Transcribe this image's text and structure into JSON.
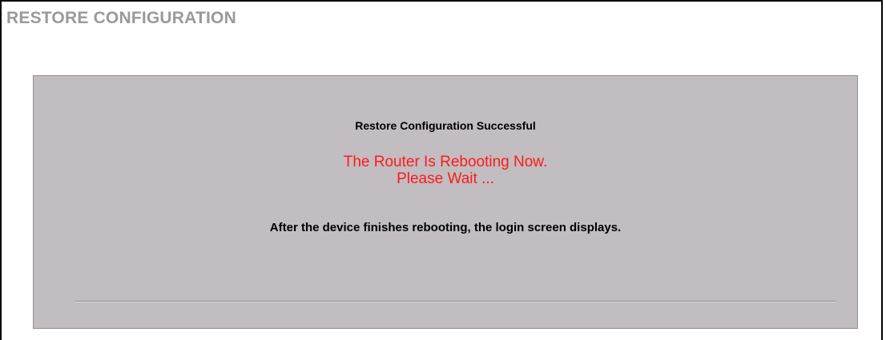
{
  "page": {
    "title": "RESTORE CONFIGURATION"
  },
  "panel": {
    "status": "Restore Configuration Successful",
    "reboot_line1": "The Router Is Rebooting Now.",
    "reboot_line2": "Please Wait ...",
    "info": "After the device finishes rebooting, the login screen displays."
  },
  "colors": {
    "title": "#9a9a9a",
    "panel_background": "#c1bdc1",
    "alert_text": "#ff1a1a",
    "text": "#000000"
  }
}
